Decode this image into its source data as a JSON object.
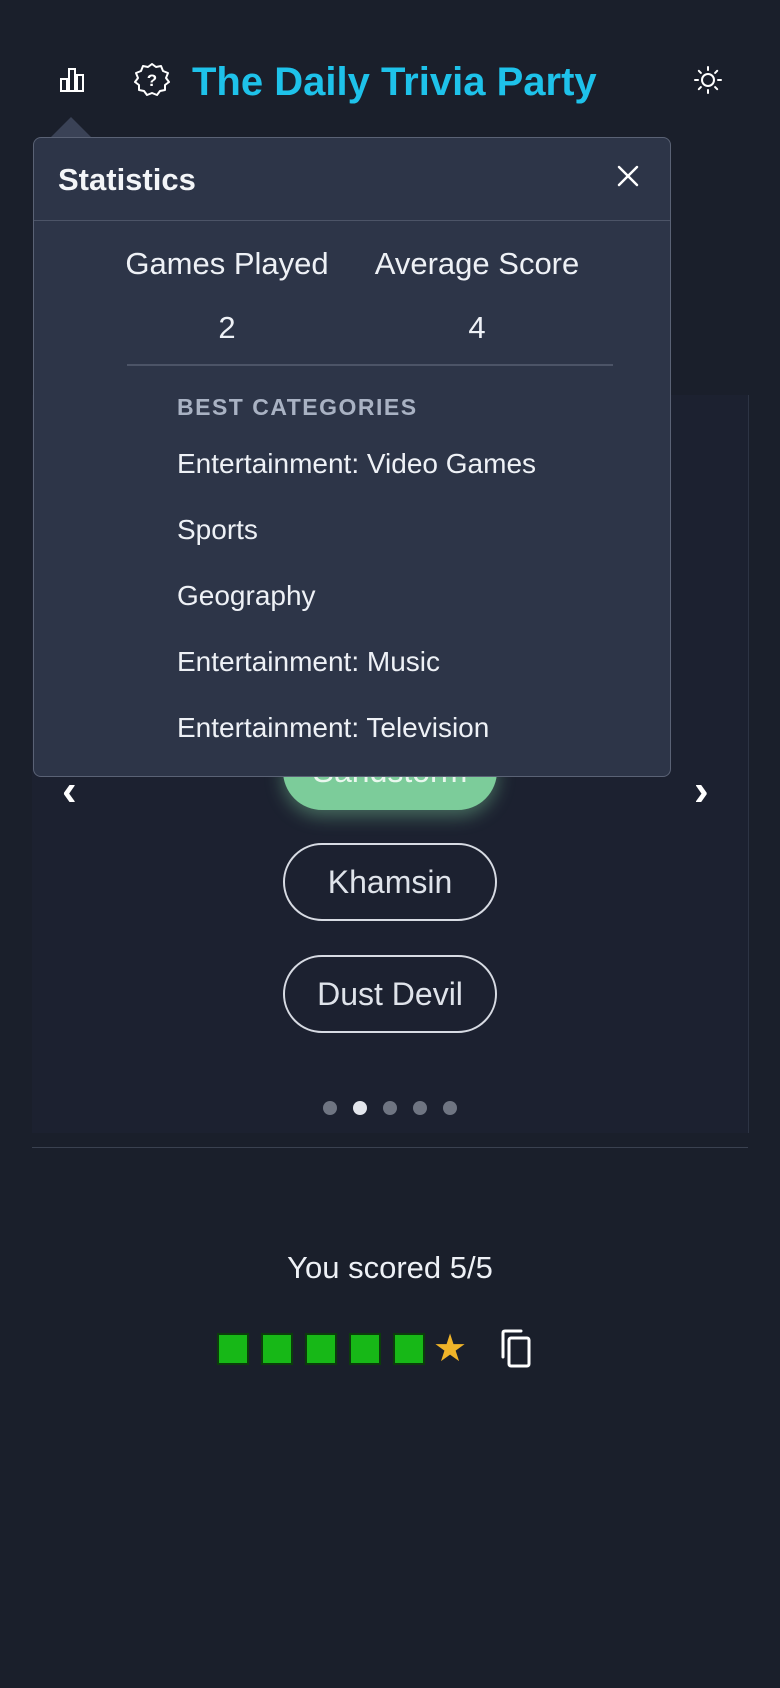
{
  "header": {
    "title": "The Daily Trivia Party",
    "icons": [
      "stats-icon",
      "help-icon",
      "theme-toggle-icon"
    ]
  },
  "quiz": {
    "answers": [
      "Sandstorm",
      "Khamsin",
      "Dust Devil"
    ],
    "correct_answer": "Sandstorm",
    "prev_arrow": "‹",
    "next_arrow": "›",
    "pagination": {
      "total": 5,
      "current": 2
    }
  },
  "stats_popover": {
    "title": "Statistics",
    "games_played_label": "Games Played",
    "games_played_value": "2",
    "average_score_label": "Average Score",
    "average_score_value": "4",
    "best_categories_heading": "BEST CATEGORIES",
    "best_categories": [
      "Entertainment: Video Games",
      "Sports",
      "Geography",
      "Entertainment: Music",
      "Entertainment: Television"
    ]
  },
  "result": {
    "score_text": "You scored 5/5",
    "squares": 5,
    "star": "★"
  },
  "colors": {
    "background": "#1a1f2b",
    "accent": "#1ec2ea",
    "correct": "#7ccc9a",
    "square": "#17b817",
    "star": "#f0b429"
  }
}
